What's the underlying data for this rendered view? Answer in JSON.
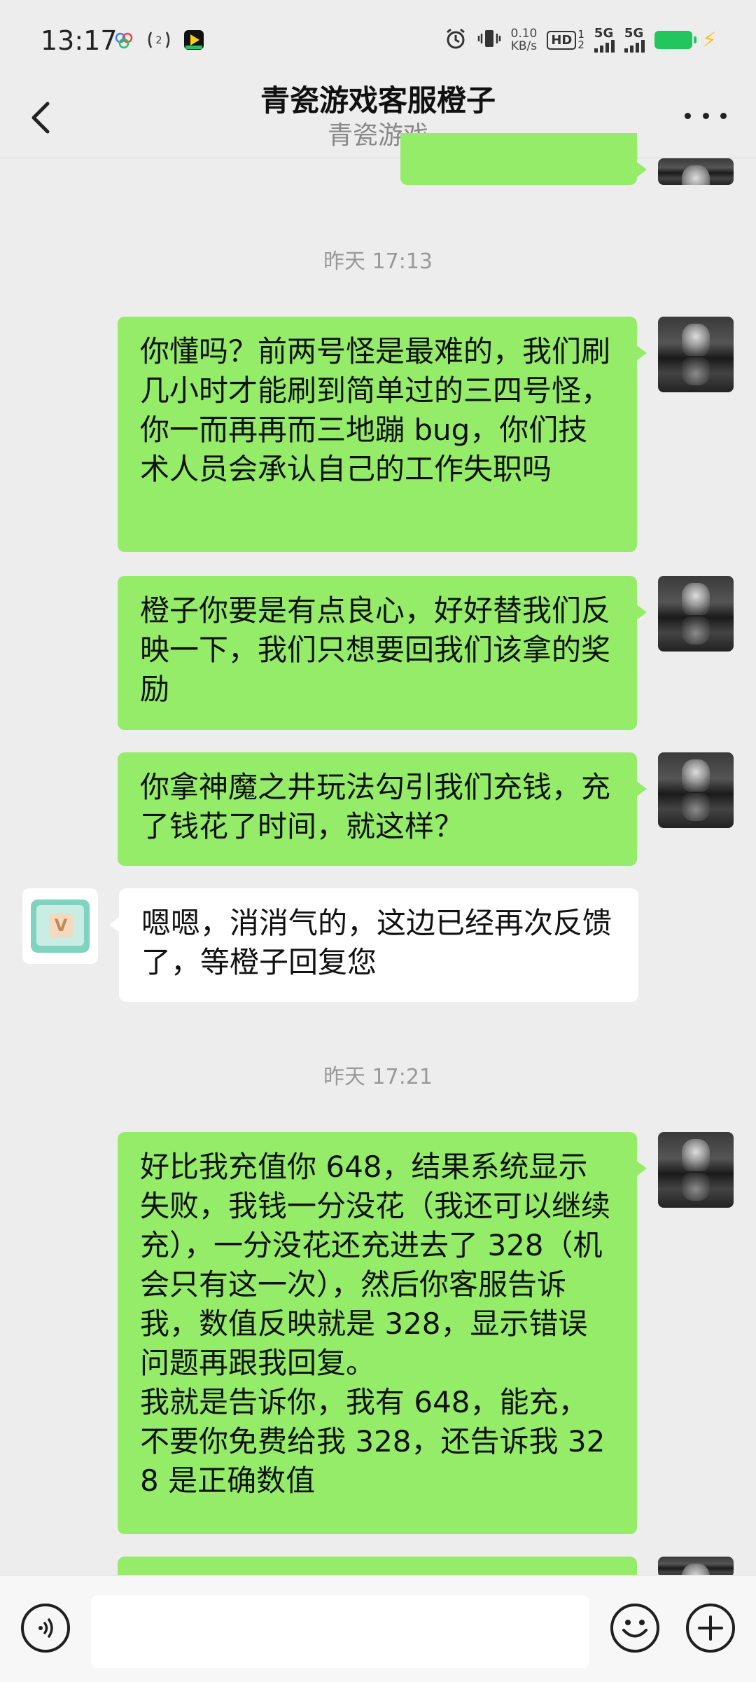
{
  "status_bar": {
    "time": "13:17",
    "net_speed_value": "0.10",
    "net_speed_unit": "KB/s",
    "hd_label": "HD",
    "hd_sub": "1",
    "hd_sub2": "2",
    "sig1_label": "5G",
    "sig2_label": "5G",
    "battery_color": "#22c55e"
  },
  "header": {
    "title": "青瓷游戏客服橙子",
    "subtitle": "青瓷游戏"
  },
  "messages": {
    "m1": "你懂吗？前两号怪是最难的，我们刷几小时才能刷到简单过的三四号怪，你一而再再而三地蹦 bug，你们技术人员会承认自己的工作失职吗",
    "m2": "橙子你要是有点良心，好好替我们反映一下，我们只想要回我们该拿的奖励",
    "m3": "你拿神魔之井玩法勾引我们充钱，充了钱花了时间，就这样？",
    "m4": "嗯嗯，消消气的，这边已经再次反馈了，等橙子回复您",
    "m5a": "好比我充值你 648，结果系统显示失败，我钱一分没花（我还可以继续充），一分没花还充进去了 328（机会只有这一次），然后你客服告诉我，数值反映就是 328，显示错误问题再跟我回复。",
    "m5b": "我就是告诉你，我有 648，能充，不要你免费给我 328，还告诉我 328 是正确数值"
  },
  "timestamps": {
    "t1": "昨天 17:13",
    "t2": "昨天 17:21"
  },
  "service_avatar_letter": "V",
  "colors": {
    "outgoing_bubble": "#95ec69",
    "incoming_bubble": "#ffffff",
    "background": "#ededed"
  }
}
